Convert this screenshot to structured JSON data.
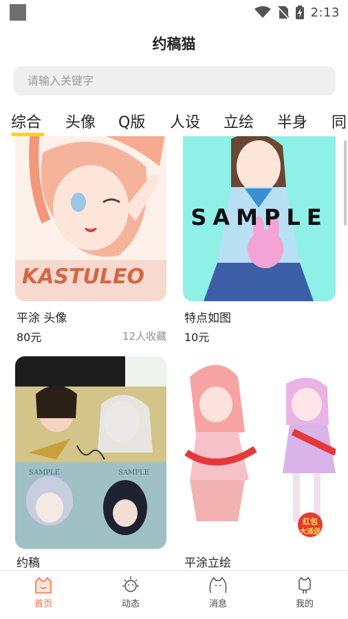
{
  "status_bar": {
    "time": "2:13"
  },
  "app_title": "约稿猫",
  "search": {
    "placeholder": "请输入关键字"
  },
  "tabs": [
    {
      "label": "综合",
      "active": true
    },
    {
      "label": "头像"
    },
    {
      "label": "Q版"
    },
    {
      "label": "人设"
    },
    {
      "label": "立绘"
    },
    {
      "label": "半身"
    },
    {
      "label": "同"
    }
  ],
  "cards": [
    {
      "title": "平涂 头像",
      "price": "80元",
      "favorites": "12人收藏",
      "image_text": "KASTULEO"
    },
    {
      "title": "特点如图",
      "price": "10元",
      "favorites": "",
      "image_text": "SAMPLE"
    },
    {
      "title": "约稿",
      "price": "",
      "favorites": "",
      "image_text": "SAMPLE"
    },
    {
      "title": "平涂立绘",
      "price": "",
      "favorites": ""
    }
  ],
  "promo_badge": {
    "line1": "红包",
    "line2": "大派送"
  },
  "bottom_nav": [
    {
      "label": "首页",
      "icon": "home-cat-icon",
      "active": true
    },
    {
      "label": "动态",
      "icon": "sun-face-icon"
    },
    {
      "label": "消息",
      "icon": "cat-message-icon"
    },
    {
      "label": "我的",
      "icon": "cat-profile-icon"
    }
  ],
  "colors": {
    "accent": "#ff6b3d",
    "tab_underline": "#ffd12a",
    "search_bg": "#efefef"
  }
}
